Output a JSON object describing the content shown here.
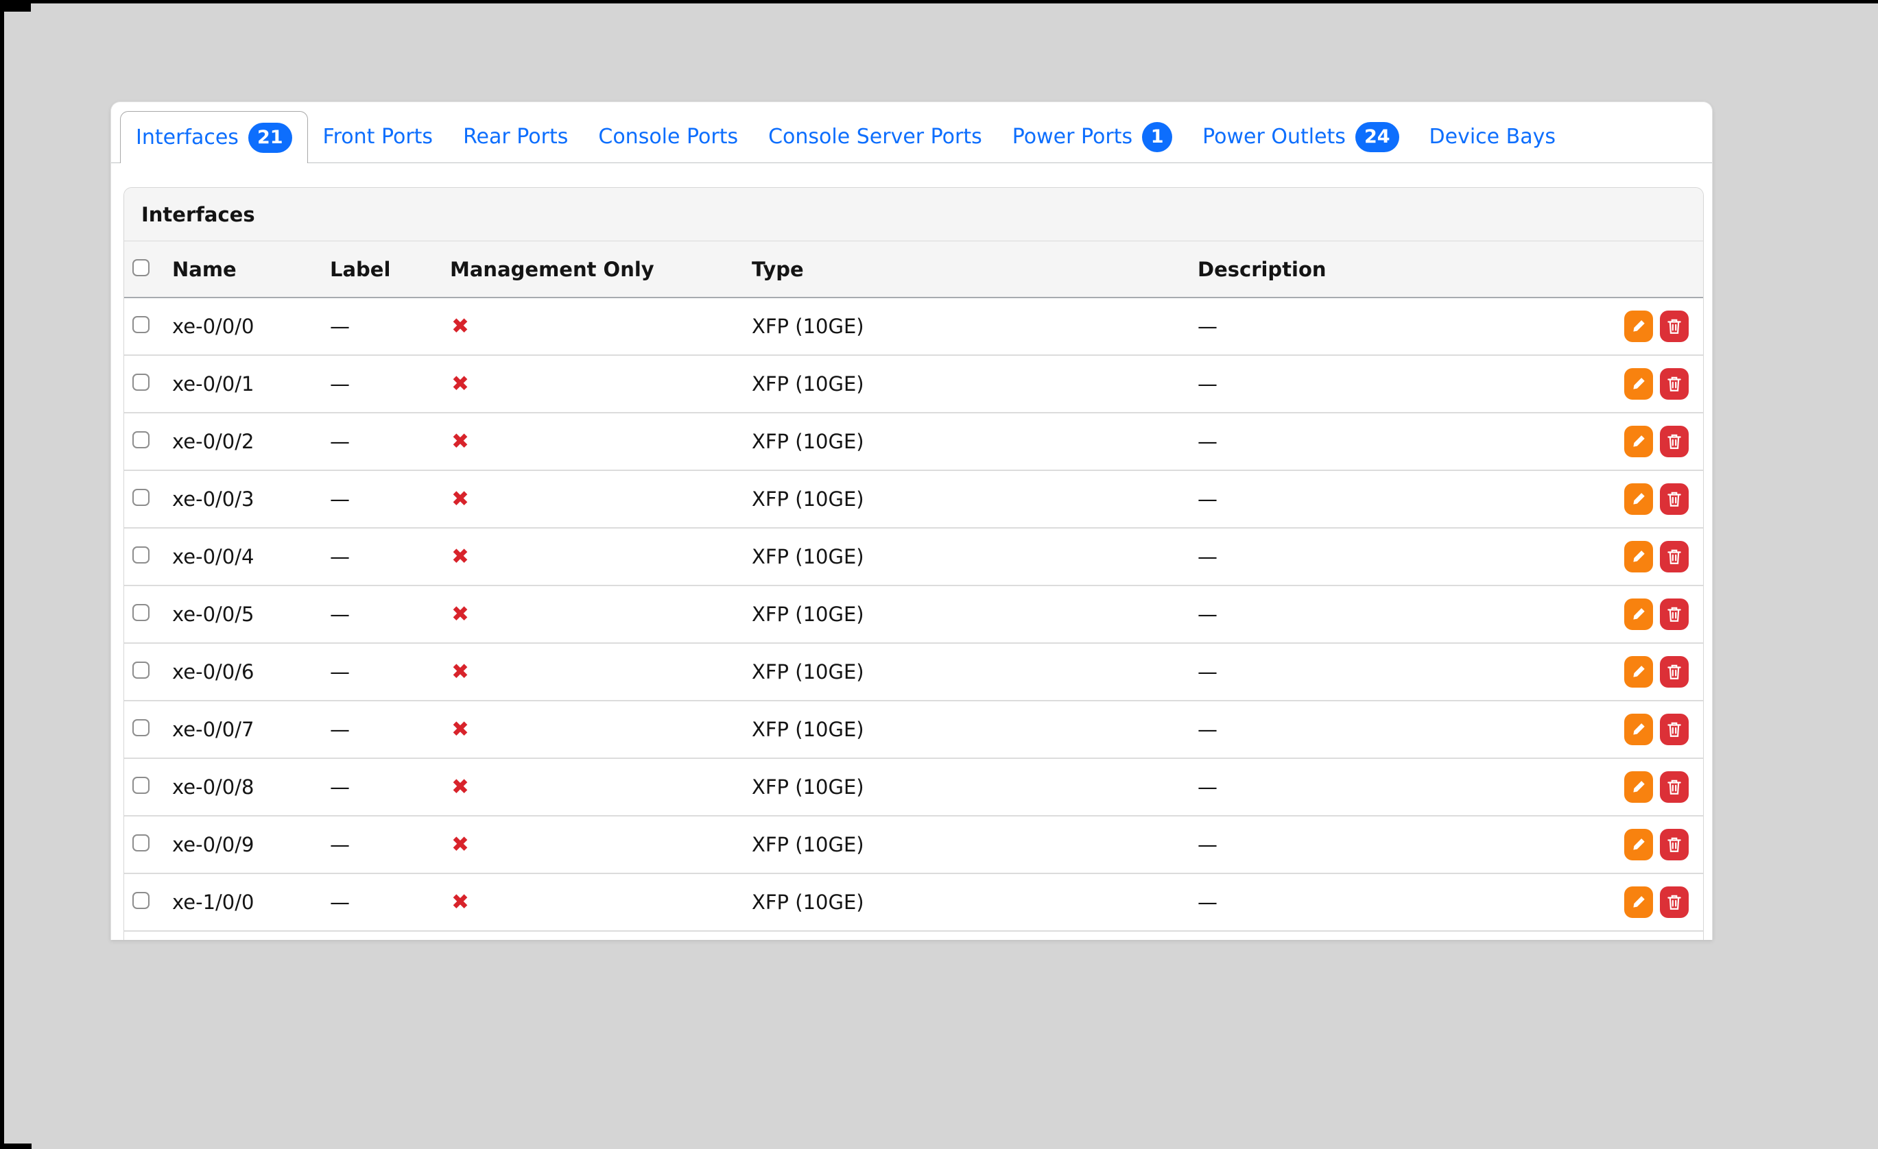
{
  "colors": {
    "page_background": "#d5d5d5",
    "accent_blue": "#0d6efd",
    "badge_blue": "#0d6efd",
    "edit_orange": "#f8820f",
    "delete_red": "#dc3037",
    "x_mark_red": "#d8232b"
  },
  "tabs": [
    {
      "label": "Interfaces",
      "badge": "21",
      "active": true
    },
    {
      "label": "Front Ports"
    },
    {
      "label": "Rear Ports"
    },
    {
      "label": "Console Ports"
    },
    {
      "label": "Console Server Ports"
    },
    {
      "label": "Power Ports",
      "badge": "1"
    },
    {
      "label": "Power Outlets",
      "badge": "24"
    },
    {
      "label": "Device Bays"
    }
  ],
  "panel": {
    "title": "Interfaces"
  },
  "table": {
    "columns": [
      "Name",
      "Label",
      "Management Only",
      "Type",
      "Description"
    ],
    "x_glyph": "✖",
    "em_dash": "—",
    "rows": [
      {
        "name": "xe-0/0/0",
        "label": "—",
        "management_only": false,
        "type": "XFP (10GE)",
        "description": "—"
      },
      {
        "name": "xe-0/0/1",
        "label": "—",
        "management_only": false,
        "type": "XFP (10GE)",
        "description": "—"
      },
      {
        "name": "xe-0/0/2",
        "label": "—",
        "management_only": false,
        "type": "XFP (10GE)",
        "description": "—"
      },
      {
        "name": "xe-0/0/3",
        "label": "—",
        "management_only": false,
        "type": "XFP (10GE)",
        "description": "—"
      },
      {
        "name": "xe-0/0/4",
        "label": "—",
        "management_only": false,
        "type": "XFP (10GE)",
        "description": "—"
      },
      {
        "name": "xe-0/0/5",
        "label": "—",
        "management_only": false,
        "type": "XFP (10GE)",
        "description": "—"
      },
      {
        "name": "xe-0/0/6",
        "label": "—",
        "management_only": false,
        "type": "XFP (10GE)",
        "description": "—"
      },
      {
        "name": "xe-0/0/7",
        "label": "—",
        "management_only": false,
        "type": "XFP (10GE)",
        "description": "—"
      },
      {
        "name": "xe-0/0/8",
        "label": "—",
        "management_only": false,
        "type": "XFP (10GE)",
        "description": "—"
      },
      {
        "name": "xe-0/0/9",
        "label": "—",
        "management_only": false,
        "type": "XFP (10GE)",
        "description": "—"
      },
      {
        "name": "xe-1/0/0",
        "label": "—",
        "management_only": false,
        "type": "XFP (10GE)",
        "description": "—"
      }
    ]
  }
}
